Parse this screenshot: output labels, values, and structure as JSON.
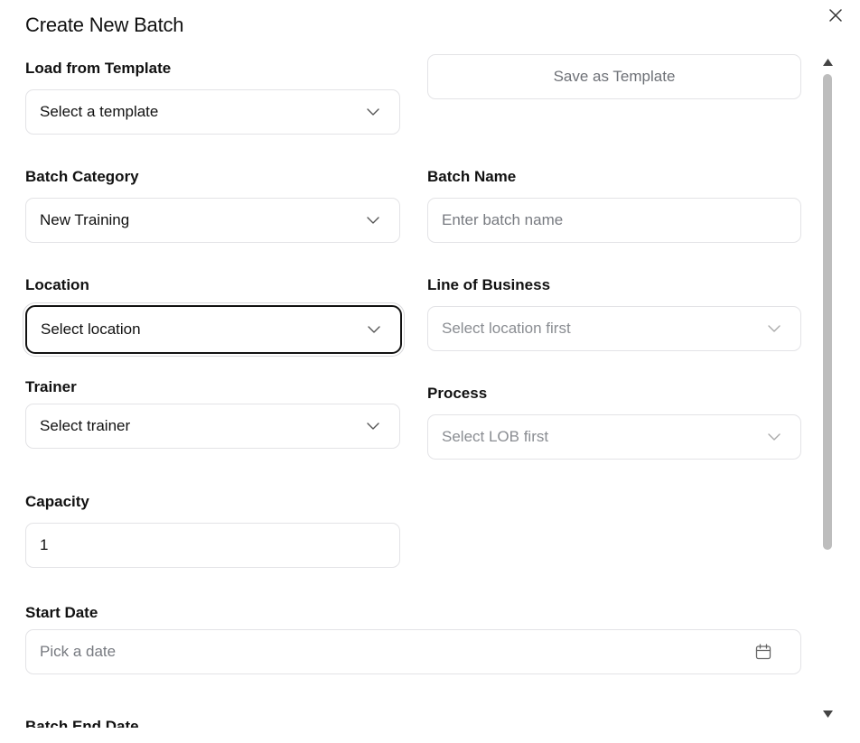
{
  "dialog": {
    "title": "Create New Batch",
    "close_icon": "close-icon"
  },
  "template": {
    "label": "Load from Template",
    "select_value": "Select a template",
    "save_button": "Save as Template"
  },
  "batch_category": {
    "label": "Batch Category",
    "value": "New Training"
  },
  "batch_name": {
    "label": "Batch Name",
    "placeholder": "Enter batch name",
    "value": ""
  },
  "location": {
    "label": "Location",
    "value": "Select location"
  },
  "line_of_business": {
    "label": "Line of Business",
    "value": "Select location first"
  },
  "trainer": {
    "label": "Trainer",
    "value": "Select trainer"
  },
  "process": {
    "label": "Process",
    "value": "Select LOB first"
  },
  "capacity": {
    "label": "Capacity",
    "value": "1"
  },
  "start_date": {
    "label": "Start Date",
    "placeholder": "Pick a date",
    "icon": "calendar-icon"
  },
  "end_date": {
    "label": "Batch End Date"
  },
  "colors": {
    "border": "#e3e3e6",
    "focus_border": "#111111",
    "placeholder": "#777a80",
    "scroll_thumb": "#bdbdbd"
  }
}
